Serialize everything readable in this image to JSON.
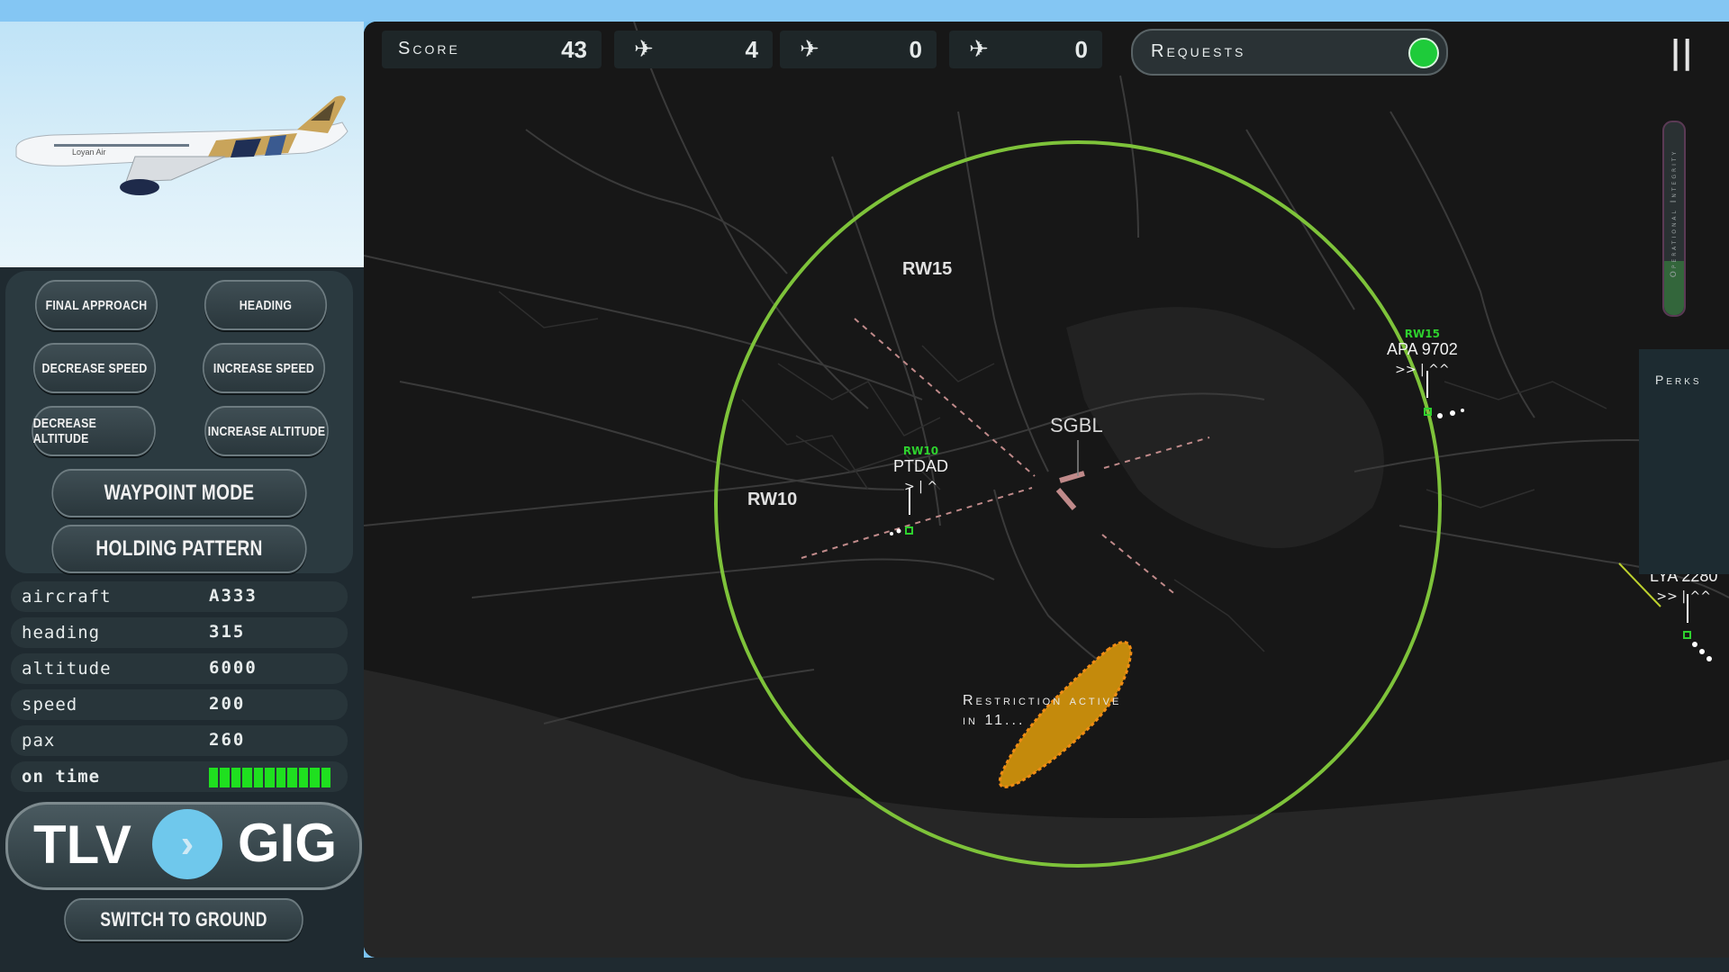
{
  "aircraft_image": {
    "airline": "Loyan Air"
  },
  "controls": {
    "final_approach": "FINAL APPROACH",
    "heading": "HEADING",
    "decrease_speed": "DECREASE SPEED",
    "increase_speed": "INCREASE SPEED",
    "decrease_altitude": "DECREASE ALTITUDE",
    "increase_altitude": "INCREASE ALTITUDE",
    "waypoint_mode": "WAYPOINT MODE",
    "holding_pattern": "HOLDING PATTERN",
    "switch_to_ground": "SWITCH TO GROUND"
  },
  "info": {
    "aircraft_label": "aircraft",
    "aircraft_value": "A333",
    "heading_label": "heading",
    "heading_value": "315",
    "altitude_label": "altitude",
    "altitude_value": "6000",
    "speed_label": "speed",
    "speed_value": "200",
    "pax_label": "pax",
    "pax_value": "260",
    "on_time_label": "on time",
    "on_time_level": 1.0
  },
  "route": {
    "from": "TLV",
    "to": "GIG",
    "arrow": "›"
  },
  "hud": {
    "score_label": "Score",
    "score_value": "43",
    "landed_value": "4",
    "departed_value": "0",
    "crashed_value": "0",
    "requests_label": "Requests",
    "pause": "||",
    "integrity_label": "Operational Integrity",
    "perks_label": "Perks"
  },
  "map": {
    "airport": "SGBL",
    "runway_a": "RW15",
    "runway_b": "RW10",
    "restriction_line1": "Restriction active",
    "restriction_line2": "in 11...",
    "flights": [
      {
        "callsign": "PTDAD",
        "runway": "RW10",
        "symbols": "> | ^"
      },
      {
        "callsign": "APA 9702",
        "runway": "RW15",
        "symbols": ">> | ^^"
      },
      {
        "callsign": "LYA 2280",
        "runway": "",
        "symbols": ">> | ^^"
      }
    ],
    "colors": {
      "range_ring": "#7ec33a",
      "restriction": "#c48a0c",
      "restriction_border": "#f08c14",
      "runway_dash": "#c08a8a",
      "flight_runway": "#2ed12e"
    }
  }
}
